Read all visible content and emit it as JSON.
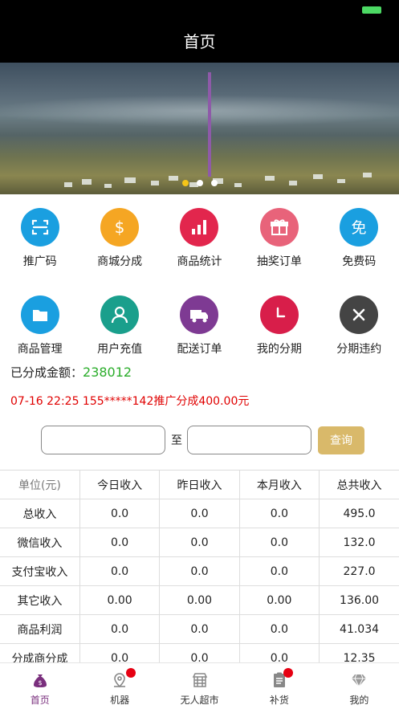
{
  "header": {
    "title": "首页"
  },
  "banner": {
    "dots": 3,
    "active_dot": 0
  },
  "menu": {
    "row1": [
      {
        "label": "推广码",
        "icon": "scan-icon",
        "color": "#1a9fe0"
      },
      {
        "label": "商城分成",
        "icon": "dollar-icon",
        "color": "#f5a623"
      },
      {
        "label": "商品统计",
        "icon": "bar-chart-icon",
        "color": "#e2264d"
      },
      {
        "label": "抽奖订单",
        "icon": "gift-icon",
        "color": "#e8637a"
      },
      {
        "label": "免费码",
        "icon": "free-icon",
        "color": "#1a9fe0"
      }
    ],
    "row2": [
      {
        "label": "商品管理",
        "icon": "folder-icon",
        "color": "#1a9fe0"
      },
      {
        "label": "用户充值",
        "icon": "user-icon",
        "color": "#1a9f8c"
      },
      {
        "label": "配送订单",
        "icon": "truck-icon",
        "color": "#7e3a93"
      },
      {
        "label": "我的分期",
        "icon": "clock-icon",
        "color": "#d81e4a"
      },
      {
        "label": "分期违约",
        "icon": "close-icon",
        "color": "#444444"
      }
    ]
  },
  "summary": {
    "label": "已分成金额：",
    "value": "238012"
  },
  "notice": "07-16 22:25 155*****142推广分成400.00元",
  "search": {
    "start_placeholder": "",
    "separator": "至",
    "end_placeholder": "",
    "button": "查询"
  },
  "table": {
    "headers": [
      "单位(元)",
      "今日收入",
      "昨日收入",
      "本月收入",
      "总共收入"
    ],
    "rows": [
      [
        "总收入",
        "0.0",
        "0.0",
        "0.0",
        "495.0"
      ],
      [
        "微信收入",
        "0.0",
        "0.0",
        "0.0",
        "132.0"
      ],
      [
        "支付宝收入",
        "0.0",
        "0.0",
        "0.0",
        "227.0"
      ],
      [
        "其它收入",
        "0.00",
        "0.00",
        "0.00",
        "136.00"
      ],
      [
        "商品利润",
        "0.0",
        "0.0",
        "0.0",
        "41.034"
      ],
      [
        "分成商分成",
        "0.0",
        "0.0",
        "0.0",
        "12.35"
      ]
    ]
  },
  "tabbar": {
    "items": [
      {
        "label": "首页",
        "icon": "money-bag-icon",
        "active": true,
        "badge": false
      },
      {
        "label": "机器",
        "icon": "location-icon",
        "active": false,
        "badge": true
      },
      {
        "label": "无人超市",
        "icon": "store-icon",
        "active": false,
        "badge": false
      },
      {
        "label": "补货",
        "icon": "clipboard-icon",
        "active": false,
        "badge": true
      },
      {
        "label": "我的",
        "icon": "diamond-icon",
        "active": false,
        "badge": false
      }
    ]
  },
  "colors": {
    "accent": "#7a2f7d",
    "amount": "#2bad2b",
    "notice": "#e00000",
    "button": "#d9b96a",
    "badge": "#e60012"
  }
}
